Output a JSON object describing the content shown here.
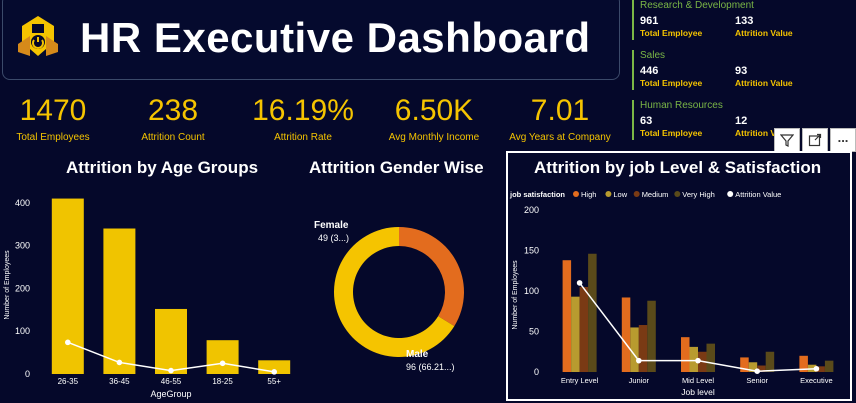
{
  "header": {
    "title": "HR Executive Dashboard",
    "logo_icon": "employee-badge-icon"
  },
  "kpis": [
    {
      "value": "1470",
      "label": "Total Employees"
    },
    {
      "value": "238",
      "label": "Attrition Count"
    },
    {
      "value": "16.19%",
      "label": "Attrition Rate"
    },
    {
      "value": "6.50K",
      "label": "Avg Monthly Income"
    },
    {
      "value": "7.01",
      "label": "Avg Years at Company"
    }
  ],
  "departments": [
    {
      "name": "Research & Development",
      "total": "961",
      "total_label": "Total Employee",
      "attrition": "133",
      "attrition_label": "Attrition Value"
    },
    {
      "name": "Sales",
      "total": "446",
      "total_label": "Total Employee",
      "attrition": "93",
      "attrition_label": "Attrition Value"
    },
    {
      "name": "Human Resources",
      "total": "63",
      "total_label": "Total Employee",
      "attrition": "12",
      "attrition_label": "Attrition Value"
    }
  ],
  "toolbar": {
    "filter_icon": "filter-icon",
    "focus_icon": "focus-mode-icon",
    "more_label": "..."
  },
  "colors": {
    "background": "#05082a",
    "accent": "#f5c400",
    "dept": "#7ab646",
    "female": "#e36c1e"
  },
  "chart_data": [
    {
      "type": "bar",
      "title": "Attrition by Age Groups",
      "xlabel": "AgeGroup",
      "ylabel": "Number of Employees",
      "categories": [
        "26-35",
        "36-45",
        "46-55",
        "18-25",
        "55+"
      ],
      "series": [
        {
          "name": "Number of Employees",
          "type": "bar",
          "values": [
            410,
            340,
            152,
            79,
            32
          ]
        },
        {
          "name": "Attrition",
          "type": "line",
          "values": [
            74,
            27,
            8,
            25,
            5
          ]
        }
      ],
      "yticks": [
        0,
        100,
        200,
        300,
        400
      ],
      "ylim": [
        0,
        430
      ]
    },
    {
      "type": "pie",
      "donut": true,
      "title": "Attrition Gender Wise",
      "slices": [
        {
          "label": "Female",
          "value": 49,
          "display": "49 (3...)",
          "color": "#e36c1e"
        },
        {
          "label": "Male",
          "value": 96,
          "display": "96 (66.21...)",
          "color": "#f5c400"
        }
      ]
    },
    {
      "type": "bar",
      "title": "Attrition by job Level & Satisfaction",
      "xlabel": "Job level",
      "ylabel": "Number of Employees",
      "legend_title": "job satisfaction",
      "legend_position": "top",
      "categories": [
        "Entry Level",
        "Junior",
        "Mid Level",
        "Senior",
        "Executive"
      ],
      "series": [
        {
          "name": "High",
          "color": "#e36c1e",
          "values": [
            138,
            92,
            43,
            18,
            20
          ]
        },
        {
          "name": "Low",
          "color": "#b89b2f",
          "values": [
            93,
            55,
            31,
            12,
            9
          ]
        },
        {
          "name": "Medium",
          "color": "#7a3a14",
          "values": [
            105,
            58,
            25,
            8,
            7
          ]
        },
        {
          "name": "Very High",
          "color": "#5a4a1a",
          "values": [
            146,
            88,
            35,
            25,
            14
          ]
        },
        {
          "name": "Attrition Value",
          "type": "line",
          "color": "#ffffff",
          "values": [
            110,
            14,
            14,
            1,
            4
          ]
        }
      ],
      "yticks": [
        0,
        50,
        100,
        150,
        200
      ],
      "ylim": [
        0,
        200
      ]
    }
  ]
}
